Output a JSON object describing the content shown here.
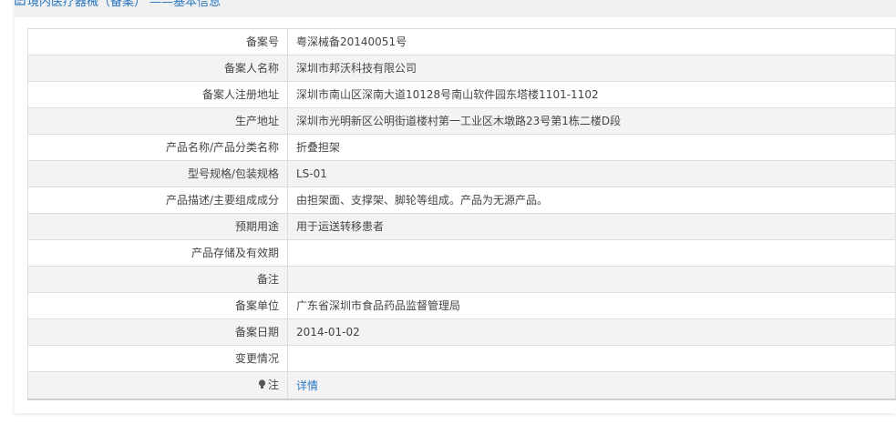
{
  "header": {
    "title": "境内医疗器械（备案） ——基本信息"
  },
  "rows": [
    {
      "label": "备案号",
      "value": "粤深械备20140051号"
    },
    {
      "label": "备案人名称",
      "value": "深圳市邦沃科技有限公司"
    },
    {
      "label": "备案人注册地址",
      "value": "深圳市南山区深南大道10128号南山软件园东塔楼1101-1102"
    },
    {
      "label": "生产地址",
      "value": "深圳市光明新区公明街道楼村第一工业区木墩路23号第1栋二楼D段"
    },
    {
      "label": "产品名称/产品分类名称",
      "value": "折叠担架"
    },
    {
      "label": "型号规格/包装规格",
      "value": "LS-01"
    },
    {
      "label": "产品描述/主要组成成分",
      "value": "由担架面、支撑架、脚轮等组成。产品为无源产品。"
    },
    {
      "label": "预期用途",
      "value": "用于运送转移患者"
    },
    {
      "label": "产品存储及有效期",
      "value": ""
    },
    {
      "label": "备注",
      "value": ""
    },
    {
      "label": "备案单位",
      "value": "广东省深圳市食品药品监督管理局"
    },
    {
      "label": "备案日期",
      "value": "2014-01-02"
    },
    {
      "label": "变更情况",
      "value": ""
    },
    {
      "label": "注",
      "value": "详情"
    }
  ],
  "colors": {
    "accent": "#2a76c0",
    "stripe": "#f3f3f3",
    "border": "#dcdcdc"
  },
  "icons": {
    "title_icon": "document-icon",
    "note_icon": "lightbulb-icon"
  }
}
